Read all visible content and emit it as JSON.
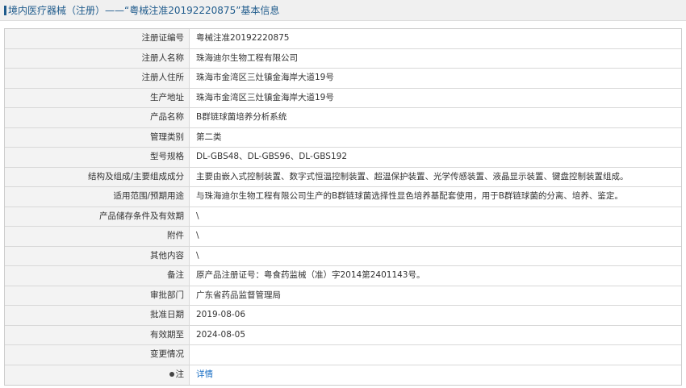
{
  "header": {
    "title": "境内医疗器械（注册）——“粤械注准20192220875”基本信息"
  },
  "colors": {
    "accent": "#1f5b8c",
    "link": "#1a6fc4",
    "label_bg": "#f3f3f3"
  },
  "rows": [
    {
      "label": "注册证编号",
      "value": "粤械注准20192220875"
    },
    {
      "label": "注册人名称",
      "value": "珠海迪尔生物工程有限公司"
    },
    {
      "label": "注册人住所",
      "value": "珠海市金湾区三灶镇金海岸大道19号"
    },
    {
      "label": "生产地址",
      "value": "珠海市金湾区三灶镇金海岸大道19号"
    },
    {
      "label": "产品名称",
      "value": "B群链球菌培养分析系统"
    },
    {
      "label": "管理类别",
      "value": "第二类"
    },
    {
      "label": "型号规格",
      "value": "DL-GBS48、DL-GBS96、DL-GBS192"
    },
    {
      "label": "结构及组成/主要组成成分",
      "value": "主要由嵌入式控制装置、数字式恒温控制装置、超温保护装置、光学传感装置、液晶显示装置、键盘控制装置组成。"
    },
    {
      "label": "适用范围/预期用途",
      "value": "与珠海迪尔生物工程有限公司生产的B群链球菌选择性显色培养基配套使用，用于B群链球菌的分离、培养、鉴定。"
    },
    {
      "label": "产品储存条件及有效期",
      "value": "\\"
    },
    {
      "label": "附件",
      "value": "\\"
    },
    {
      "label": "其他内容",
      "value": "\\"
    },
    {
      "label": "备注",
      "value": "原产品注册证号：粤食药监械（准）字2014第2401143号。"
    },
    {
      "label": "审批部门",
      "value": "广东省药品监督管理局"
    },
    {
      "label": "批准日期",
      "value": "2019-08-06"
    },
    {
      "label": "有效期至",
      "value": "2024-08-05"
    },
    {
      "label": "变更情况",
      "value": ""
    }
  ],
  "note_row": {
    "label": "注",
    "icon": "pin-icon",
    "link_text": "详情"
  }
}
